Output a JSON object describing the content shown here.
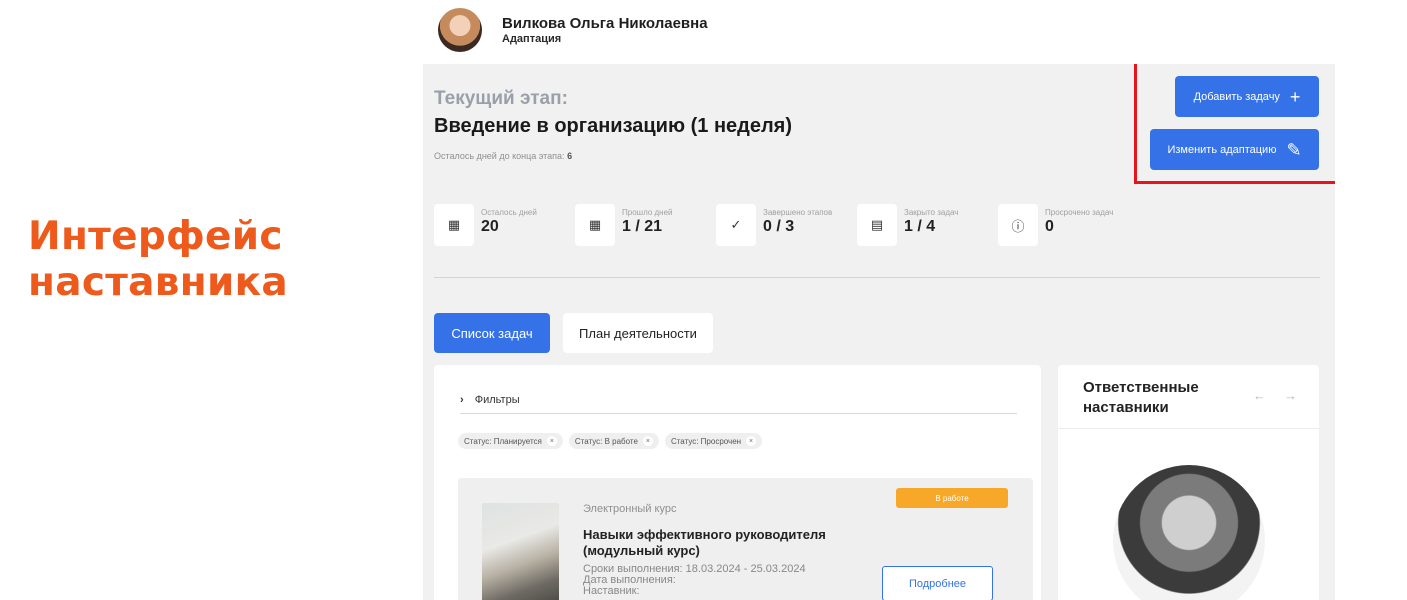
{
  "caption": {
    "line1": "Интерфейс",
    "line2": "наставника"
  },
  "header": {
    "user_name": "Вилкова Ольга Николаевна",
    "subtitle": "Адаптация"
  },
  "stage": {
    "label": "Текущий этап:",
    "title": "Введение в организацию (1 неделя)",
    "days_left_label": "Осталось дней до конца этапа:",
    "days_left_value": "6"
  },
  "actions": {
    "add_task": "Добавить задачу",
    "change_adaptation": "Изменить адаптацию"
  },
  "stats": [
    {
      "label": "Осталось дней",
      "value": "20",
      "icon": "calendar-icon"
    },
    {
      "label": "Прошло дней",
      "value": "1 / 21",
      "icon": "calendar-icon"
    },
    {
      "label": "Завершено этапов",
      "value": "0 / 3",
      "icon": "check-circle-icon"
    },
    {
      "label": "Закрыто задач",
      "value": "1 / 4",
      "icon": "task-icon"
    },
    {
      "label": "Просрочено задач",
      "value": "0",
      "icon": "alert-icon"
    }
  ],
  "tabs": [
    {
      "label": "Список задач"
    },
    {
      "label": "План деятельности"
    }
  ],
  "filters": {
    "label": "Фильтры",
    "chips": [
      {
        "label": "Статус: Планируется"
      },
      {
        "label": "Статус: В работе"
      },
      {
        "label": "Статус: Просрочен"
      }
    ]
  },
  "task": {
    "type": "Электронный курс",
    "title": "Навыки эффективного руководителя (модульный курс)",
    "deadline": "Сроки выполнения: 18.03.2024 - 25.03.2024",
    "completion_date": "Дата выполнения:",
    "mentor": "Наставник:",
    "status": "В работе",
    "details_button": "Подробнее"
  },
  "mentors": {
    "title": "Ответственные наставники",
    "prev": "←",
    "next": "→"
  },
  "colors": {
    "accent": "#3572e8",
    "caption": "#ee5a1c",
    "status": "#f7a828",
    "highlight": "#e8141b"
  }
}
